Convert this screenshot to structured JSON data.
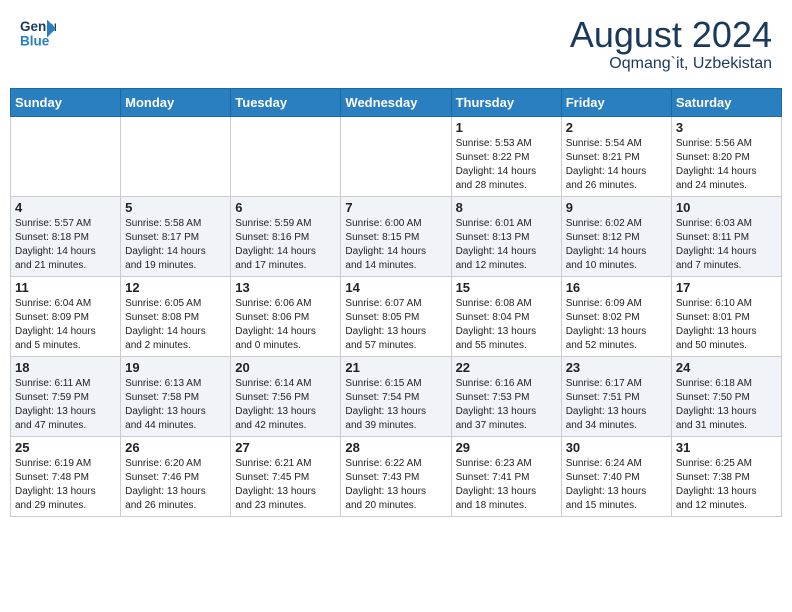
{
  "header": {
    "logo_line1": "General",
    "logo_line2": "Blue",
    "title": "August 2024",
    "subtitle": "Oqmang`it, Uzbekistan"
  },
  "weekdays": [
    "Sunday",
    "Monday",
    "Tuesday",
    "Wednesday",
    "Thursday",
    "Friday",
    "Saturday"
  ],
  "weeks": [
    [
      {
        "day": "",
        "info": ""
      },
      {
        "day": "",
        "info": ""
      },
      {
        "day": "",
        "info": ""
      },
      {
        "day": "",
        "info": ""
      },
      {
        "day": "1",
        "info": "Sunrise: 5:53 AM\nSunset: 8:22 PM\nDaylight: 14 hours\nand 28 minutes."
      },
      {
        "day": "2",
        "info": "Sunrise: 5:54 AM\nSunset: 8:21 PM\nDaylight: 14 hours\nand 26 minutes."
      },
      {
        "day": "3",
        "info": "Sunrise: 5:56 AM\nSunset: 8:20 PM\nDaylight: 14 hours\nand 24 minutes."
      }
    ],
    [
      {
        "day": "4",
        "info": "Sunrise: 5:57 AM\nSunset: 8:18 PM\nDaylight: 14 hours\nand 21 minutes."
      },
      {
        "day": "5",
        "info": "Sunrise: 5:58 AM\nSunset: 8:17 PM\nDaylight: 14 hours\nand 19 minutes."
      },
      {
        "day": "6",
        "info": "Sunrise: 5:59 AM\nSunset: 8:16 PM\nDaylight: 14 hours\nand 17 minutes."
      },
      {
        "day": "7",
        "info": "Sunrise: 6:00 AM\nSunset: 8:15 PM\nDaylight: 14 hours\nand 14 minutes."
      },
      {
        "day": "8",
        "info": "Sunrise: 6:01 AM\nSunset: 8:13 PM\nDaylight: 14 hours\nand 12 minutes."
      },
      {
        "day": "9",
        "info": "Sunrise: 6:02 AM\nSunset: 8:12 PM\nDaylight: 14 hours\nand 10 minutes."
      },
      {
        "day": "10",
        "info": "Sunrise: 6:03 AM\nSunset: 8:11 PM\nDaylight: 14 hours\nand 7 minutes."
      }
    ],
    [
      {
        "day": "11",
        "info": "Sunrise: 6:04 AM\nSunset: 8:09 PM\nDaylight: 14 hours\nand 5 minutes."
      },
      {
        "day": "12",
        "info": "Sunrise: 6:05 AM\nSunset: 8:08 PM\nDaylight: 14 hours\nand 2 minutes."
      },
      {
        "day": "13",
        "info": "Sunrise: 6:06 AM\nSunset: 8:06 PM\nDaylight: 14 hours\nand 0 minutes."
      },
      {
        "day": "14",
        "info": "Sunrise: 6:07 AM\nSunset: 8:05 PM\nDaylight: 13 hours\nand 57 minutes."
      },
      {
        "day": "15",
        "info": "Sunrise: 6:08 AM\nSunset: 8:04 PM\nDaylight: 13 hours\nand 55 minutes."
      },
      {
        "day": "16",
        "info": "Sunrise: 6:09 AM\nSunset: 8:02 PM\nDaylight: 13 hours\nand 52 minutes."
      },
      {
        "day": "17",
        "info": "Sunrise: 6:10 AM\nSunset: 8:01 PM\nDaylight: 13 hours\nand 50 minutes."
      }
    ],
    [
      {
        "day": "18",
        "info": "Sunrise: 6:11 AM\nSunset: 7:59 PM\nDaylight: 13 hours\nand 47 minutes."
      },
      {
        "day": "19",
        "info": "Sunrise: 6:13 AM\nSunset: 7:58 PM\nDaylight: 13 hours\nand 44 minutes."
      },
      {
        "day": "20",
        "info": "Sunrise: 6:14 AM\nSunset: 7:56 PM\nDaylight: 13 hours\nand 42 minutes."
      },
      {
        "day": "21",
        "info": "Sunrise: 6:15 AM\nSunset: 7:54 PM\nDaylight: 13 hours\nand 39 minutes."
      },
      {
        "day": "22",
        "info": "Sunrise: 6:16 AM\nSunset: 7:53 PM\nDaylight: 13 hours\nand 37 minutes."
      },
      {
        "day": "23",
        "info": "Sunrise: 6:17 AM\nSunset: 7:51 PM\nDaylight: 13 hours\nand 34 minutes."
      },
      {
        "day": "24",
        "info": "Sunrise: 6:18 AM\nSunset: 7:50 PM\nDaylight: 13 hours\nand 31 minutes."
      }
    ],
    [
      {
        "day": "25",
        "info": "Sunrise: 6:19 AM\nSunset: 7:48 PM\nDaylight: 13 hours\nand 29 minutes."
      },
      {
        "day": "26",
        "info": "Sunrise: 6:20 AM\nSunset: 7:46 PM\nDaylight: 13 hours\nand 26 minutes."
      },
      {
        "day": "27",
        "info": "Sunrise: 6:21 AM\nSunset: 7:45 PM\nDaylight: 13 hours\nand 23 minutes."
      },
      {
        "day": "28",
        "info": "Sunrise: 6:22 AM\nSunset: 7:43 PM\nDaylight: 13 hours\nand 20 minutes."
      },
      {
        "day": "29",
        "info": "Sunrise: 6:23 AM\nSunset: 7:41 PM\nDaylight: 13 hours\nand 18 minutes."
      },
      {
        "day": "30",
        "info": "Sunrise: 6:24 AM\nSunset: 7:40 PM\nDaylight: 13 hours\nand 15 minutes."
      },
      {
        "day": "31",
        "info": "Sunrise: 6:25 AM\nSunset: 7:38 PM\nDaylight: 13 hours\nand 12 minutes."
      }
    ]
  ]
}
